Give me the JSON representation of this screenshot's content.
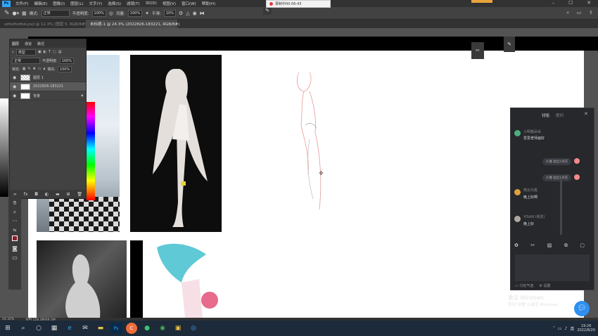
{
  "menubar": {
    "items": [
      "文件(F)",
      "编辑(E)",
      "图像(I)",
      "图层(L)",
      "文字(Y)",
      "选择(S)",
      "滤镜(T)",
      "3D(D)",
      "视图(V)",
      "窗口(W)",
      "帮助(H)"
    ],
    "logo": "Ps"
  },
  "options_bar": {
    "mode_label": "模式:",
    "mode_value": "正常",
    "opacity_label": "不透明度:",
    "opacity_value": "100%",
    "flow_label": "流量:",
    "flow_value": "100%",
    "smooth_label": "平滑:",
    "smooth_value": "10%"
  },
  "recording": {
    "text": "录制中00:06:43"
  },
  "tabs": [
    {
      "label": "sdfsdfsdfsd.psd @ 12.3% (图层 5, RGB/8#)",
      "active": false
    },
    {
      "label": "未标题-1 @ 24.3% (2022826-183221, RGB/8#)",
      "active": true
    }
  ],
  "layers_panel": {
    "tabs": [
      "图层",
      "通道",
      "路径"
    ],
    "kind_label": "类型",
    "blend_mode": "正常",
    "opacity_label": "不透明度:",
    "opacity_value": "100%",
    "lock_label": "锁定:",
    "fill_label": "填充:",
    "fill_value": "100%",
    "layers": [
      {
        "name": "图层 1",
        "selected": false
      },
      {
        "name": "2022826-183221",
        "selected": true
      },
      {
        "name": "背景",
        "selected": false
      }
    ]
  },
  "chat": {
    "tabs": [
      "讨论",
      "提问"
    ],
    "messages": [
      {
        "user": "小明箱朵朵",
        "text": "爱爱老师画好",
        "avatar_color": "#4caf83"
      },
      {
        "user": "熊云为极",
        "text": "晚上好啊",
        "avatar_color": "#e0a13a"
      },
      {
        "user": "YISAN (我发)",
        "text": "晚上好",
        "avatar_color": "#b0a8a0"
      }
    ],
    "flowers": [
      "头懵 送出1朵花",
      "头懵 送出1朵花"
    ],
    "footer_left": "讨论气泡",
    "footer_right": "设置"
  },
  "watermark": {
    "line1": "激活 Windows",
    "line2": "转到\"设置\"以激活 Windows。"
  },
  "status": {
    "zoom": "24.32%",
    "doc": "文档:128.3M/69.5M"
  },
  "taskbar": {
    "time": "19:26",
    "date": "2022/8/20",
    "ime": "英"
  }
}
